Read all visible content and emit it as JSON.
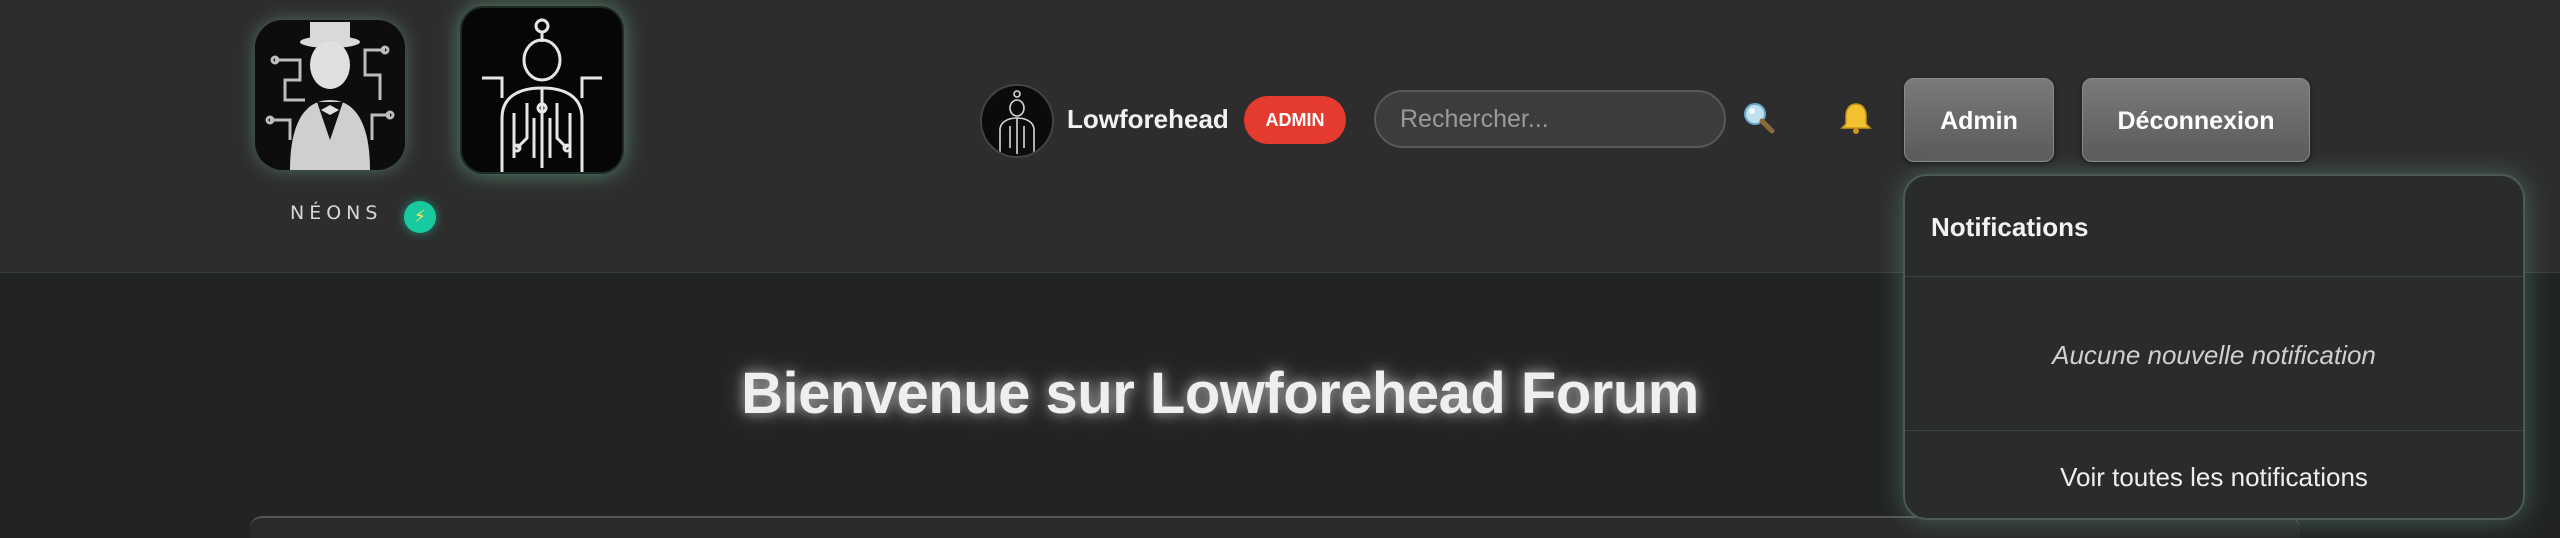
{
  "brand": {
    "name": "NÉONS",
    "badge_icon": "lightning-icon",
    "badge_symbol": "⚡"
  },
  "user": {
    "name": "Lowforehead",
    "role_badge": "ADMIN"
  },
  "search": {
    "placeholder": "Rechercher...",
    "icon": "search-icon"
  },
  "header_buttons": {
    "admin_label": "Admin",
    "logout_label": "Déconnexion"
  },
  "notifications": {
    "title": "Notifications",
    "empty_message": "Aucune nouvelle notification",
    "view_all_label": "Voir toutes les notifications"
  },
  "main": {
    "welcome_title": "Bienvenue sur Lowforehead Forum"
  },
  "colors": {
    "accent_red": "#e53b2f",
    "badge_teal": "#19c9a0",
    "background": "#222424",
    "header": "#2d2d2d"
  }
}
